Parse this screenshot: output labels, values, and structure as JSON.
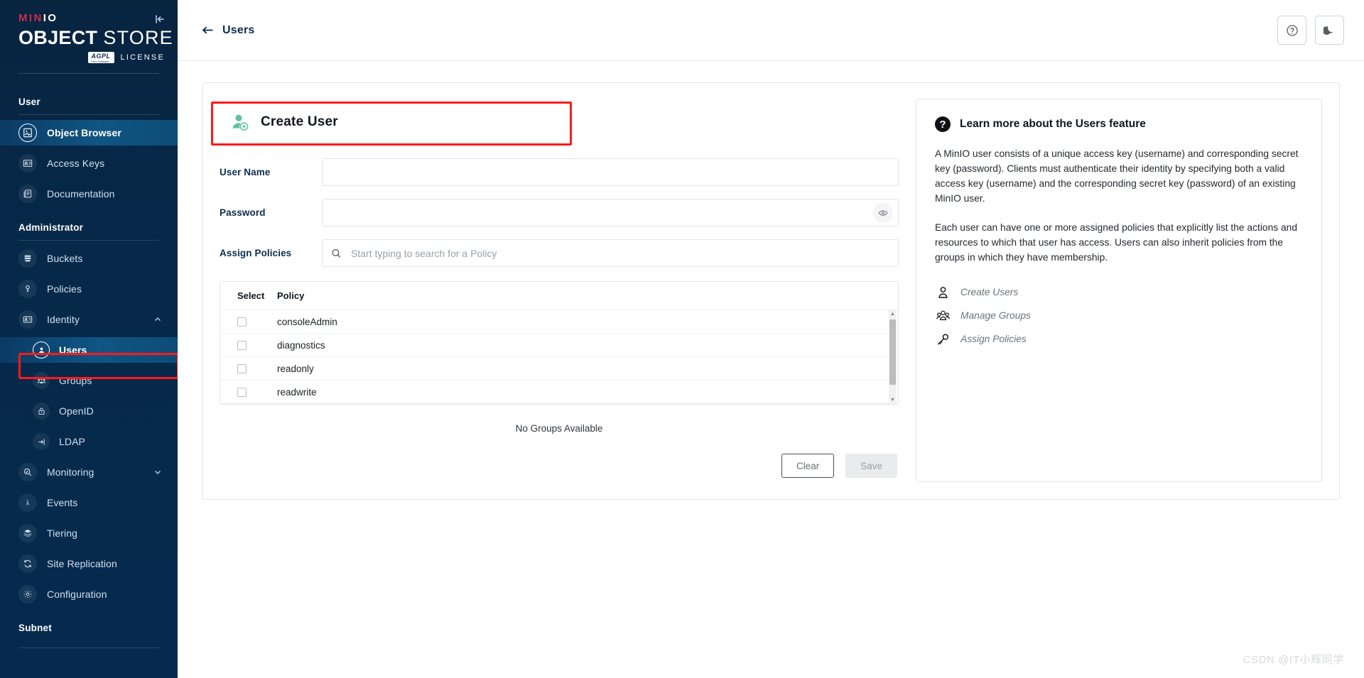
{
  "sidebar": {
    "logo": {
      "brand_min": "MIN",
      "brand_io": "IO",
      "object": "OBJECT",
      "store": "STORE",
      "agpl": "AGPL",
      "agpl_sub": "Free Software",
      "license": "LICENSE"
    },
    "collapse_tooltip": "Collapse",
    "sections": [
      {
        "title": "User",
        "items": [
          {
            "label": "Object Browser",
            "icon": "object-browser-icon",
            "active": true
          },
          {
            "label": "Access Keys",
            "icon": "access-keys-icon",
            "active": false
          },
          {
            "label": "Documentation",
            "icon": "documentation-icon",
            "active": false
          }
        ]
      },
      {
        "title": "Administrator",
        "items": [
          {
            "label": "Buckets",
            "icon": "buckets-icon",
            "active": false
          },
          {
            "label": "Policies",
            "icon": "policies-icon",
            "active": false
          },
          {
            "label": "Identity",
            "icon": "identity-icon",
            "active": false,
            "chevron": "chevron-up-icon"
          },
          {
            "label": "Users",
            "icon": "users-icon",
            "active": true,
            "sub": true,
            "highlighted": true
          },
          {
            "label": "Groups",
            "icon": "groups-icon",
            "active": false,
            "sub": true
          },
          {
            "label": "OpenID",
            "icon": "openid-icon",
            "active": false,
            "sub": true
          },
          {
            "label": "LDAP",
            "icon": "ldap-icon",
            "active": false,
            "sub": true
          },
          {
            "label": "Monitoring",
            "icon": "monitoring-icon",
            "active": false,
            "chevron": "chevron-down-icon"
          },
          {
            "label": "Events",
            "icon": "events-icon",
            "active": false
          },
          {
            "label": "Tiering",
            "icon": "tiering-icon",
            "active": false
          },
          {
            "label": "Site Replication",
            "icon": "site-replication-icon",
            "active": false
          },
          {
            "label": "Configuration",
            "icon": "configuration-icon",
            "active": false
          }
        ]
      },
      {
        "title": "Subnet",
        "items": []
      }
    ]
  },
  "topbar": {
    "back_label": "←",
    "title": "Users",
    "help_button": "help-icon",
    "theme_button": "dark-mode-icon"
  },
  "form": {
    "header_title": "Create User",
    "header_icon": "add-user-icon",
    "user_name": {
      "label": "User Name",
      "value": "",
      "placeholder": ""
    },
    "password": {
      "label": "Password",
      "value": "",
      "placeholder": "",
      "toggle_icon": "eye-icon"
    },
    "assign_policies": {
      "label": "Assign Policies",
      "value": "",
      "placeholder": "Start typing to search for a Policy",
      "search_icon": "search-icon"
    },
    "policy_table": {
      "columns": [
        "Select",
        "Policy"
      ],
      "rows": [
        {
          "name": "consoleAdmin",
          "checked": false
        },
        {
          "name": "diagnostics",
          "checked": false
        },
        {
          "name": "readonly",
          "checked": false
        },
        {
          "name": "readwrite",
          "checked": false
        }
      ]
    },
    "no_groups_text": "No Groups Available",
    "buttons": {
      "clear": "Clear",
      "save": "Save"
    }
  },
  "help": {
    "title": "Learn more about the Users feature",
    "icon": "question-mark-icon",
    "paragraph1": "A MinIO user consists of a unique access key (username) and corresponding secret key (password). Clients must authenticate their identity by specifying both a valid access key (username) and the corresponding secret key (password) of an existing MinIO user.",
    "paragraph2": "Each user can have one or more assigned policies that explicitly list the actions and resources to which that user has access. Users can also inherit policies from the groups in which they have membership.",
    "links": [
      {
        "label": "Create Users",
        "icon": "person-icon"
      },
      {
        "label": "Manage Groups",
        "icon": "people-icon"
      },
      {
        "label": "Assign Policies",
        "icon": "key-icon"
      }
    ]
  },
  "watermark": "CSDN @IT小辉同学",
  "colors": {
    "sidebar_bg": "#072a4d",
    "accent_active": "#105584",
    "annotation_red": "#ff1a1a",
    "create_user_green": "#5fc49a",
    "title_navy": "#0b2d4d"
  }
}
